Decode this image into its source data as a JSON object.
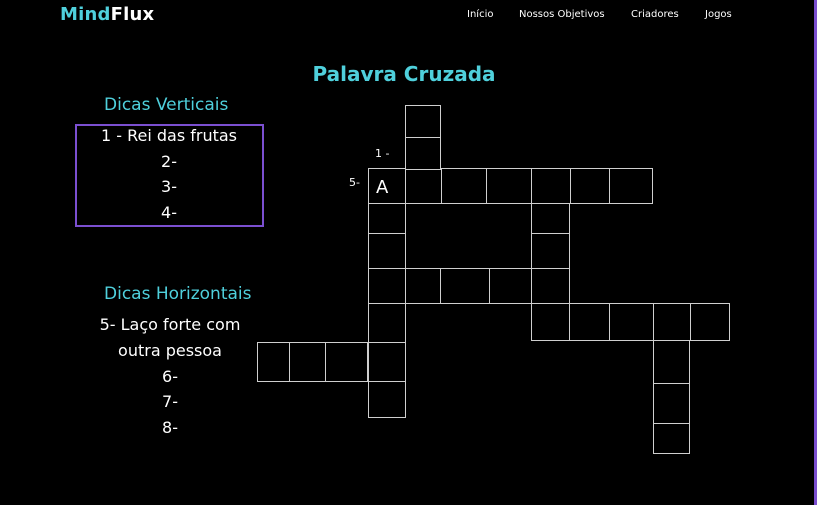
{
  "header": {
    "logo_part1": "Mind",
    "logo_part2": "Flux",
    "nav": [
      "Início",
      "Nossos Objetivos",
      "Criadores",
      "Jogos"
    ]
  },
  "page_title": "Palavra Cruzada",
  "vertical": {
    "title": "Dicas Verticais",
    "clues": [
      "1 - Rei das frutas",
      "2-",
      "3-",
      "4-"
    ]
  },
  "horizontal": {
    "title": "Dicas Horizontais",
    "clues": [
      "5- Laço forte com",
      "outra pessoa",
      "6-",
      "7-",
      "8-"
    ]
  },
  "grid": {
    "label_1": "1 -",
    "label_5": "5-",
    "filled_letter": "A"
  },
  "colors": {
    "accent": "#4fd0dc",
    "border": "#7b4fd0",
    "background": "#000000"
  }
}
